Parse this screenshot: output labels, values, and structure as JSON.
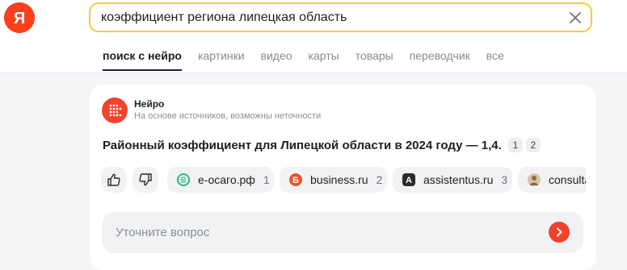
{
  "logo": {
    "letter": "Я"
  },
  "search": {
    "query": "коэффициент региона липецкая область"
  },
  "tabs": [
    {
      "label": "поиск с нейро",
      "active": true
    },
    {
      "label": "картинки"
    },
    {
      "label": "видео"
    },
    {
      "label": "карты"
    },
    {
      "label": "товары"
    },
    {
      "label": "переводчик"
    },
    {
      "label": "все"
    }
  ],
  "neuro": {
    "title": "Нейро",
    "subtitle": "На основе источников, возможны неточности",
    "answer": "Районный коэффициент для Липецкой области в 2024 году — 1,4.",
    "refs": [
      "1",
      "2"
    ]
  },
  "sources": [
    {
      "icon": "like-icon"
    },
    {
      "icon": "dislike-icon"
    },
    {
      "label": "е-осаго.рф",
      "count": "1",
      "icon": "eosago-logo-icon",
      "color": "#2fb67a"
    },
    {
      "label": "business.ru",
      "count": "2",
      "icon": "business-logo-icon",
      "color": "#e8552a"
    },
    {
      "label": "assistentus.ru",
      "count": "3",
      "icon": "assistentus-logo-icon",
      "color": "#2b2b2b"
    },
    {
      "label": "consulta",
      "icon": "consultant-logo-icon",
      "color": "#8a6a4f"
    }
  ],
  "ask": {
    "placeholder": "Уточните вопрос"
  },
  "colors": {
    "accent": "#f1432c",
    "search_border": "#f2cd3c"
  }
}
